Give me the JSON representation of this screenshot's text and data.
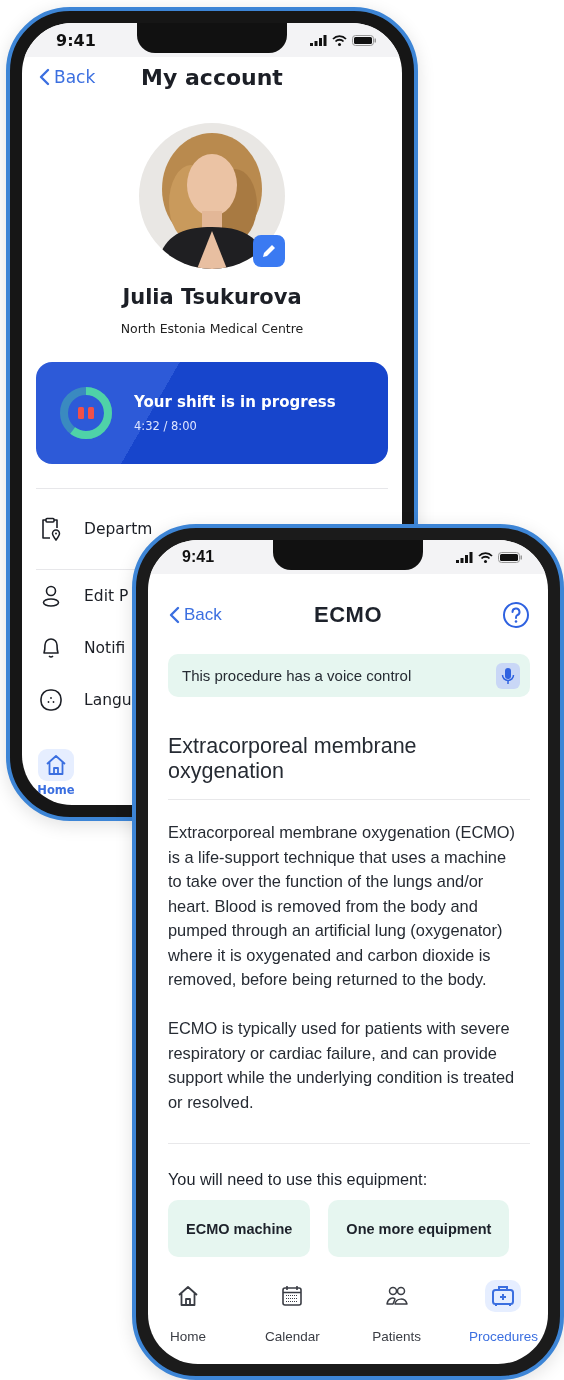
{
  "account_screen": {
    "status_time": "9:41",
    "back_link": "Back",
    "title": "My account",
    "name": "Julia Tsukurova",
    "organization": "North Estonia Medical Centre",
    "shift": {
      "title": "Your shift is in progress",
      "time": "4:32 / 8:00",
      "level": 0.6
    },
    "menu": [
      {
        "kind": "department",
        "label": "Departm"
      },
      {
        "kind": "profile",
        "label": "Edit P"
      },
      {
        "kind": "notifications",
        "label": "Notifi"
      },
      {
        "kind": "language",
        "label": "Langu"
      }
    ],
    "nav": [
      {
        "kind": "home",
        "label": "Home",
        "selected": true
      }
    ]
  },
  "procedure_screen": {
    "status_time": "9:41",
    "back_link": "Back",
    "title": "ECMO",
    "voice_banner": "This procedure has a voice control",
    "heading": "Extracorporeal membrane oxygenation",
    "paragraphs": [
      "Extracorporeal membrane oxygenation (ECMO) is a life-support technique that uses a machine to take over the function of the lungs and/or heart. Blood is removed from the body and pumped through an artificial lung (oxygenator) where it is oxygenated and carbon dioxide is removed, before being returned to the body.",
      "ECMO is typically used for patients with severe respiratory or cardiac failure, and can provide support while the underlying condition is treated or resolved."
    ],
    "equipment_label": "You will need to use this equipment:",
    "equipment": [
      "ECMO machine",
      "One more equipment"
    ],
    "nav": [
      {
        "kind": "home",
        "label": "Home",
        "selected": false
      },
      {
        "kind": "calendar",
        "label": "Calendar",
        "selected": false
      },
      {
        "kind": "patients",
        "label": "Patients",
        "selected": false
      },
      {
        "kind": "procedures",
        "label": "Procedures",
        "selected": true
      }
    ]
  }
}
